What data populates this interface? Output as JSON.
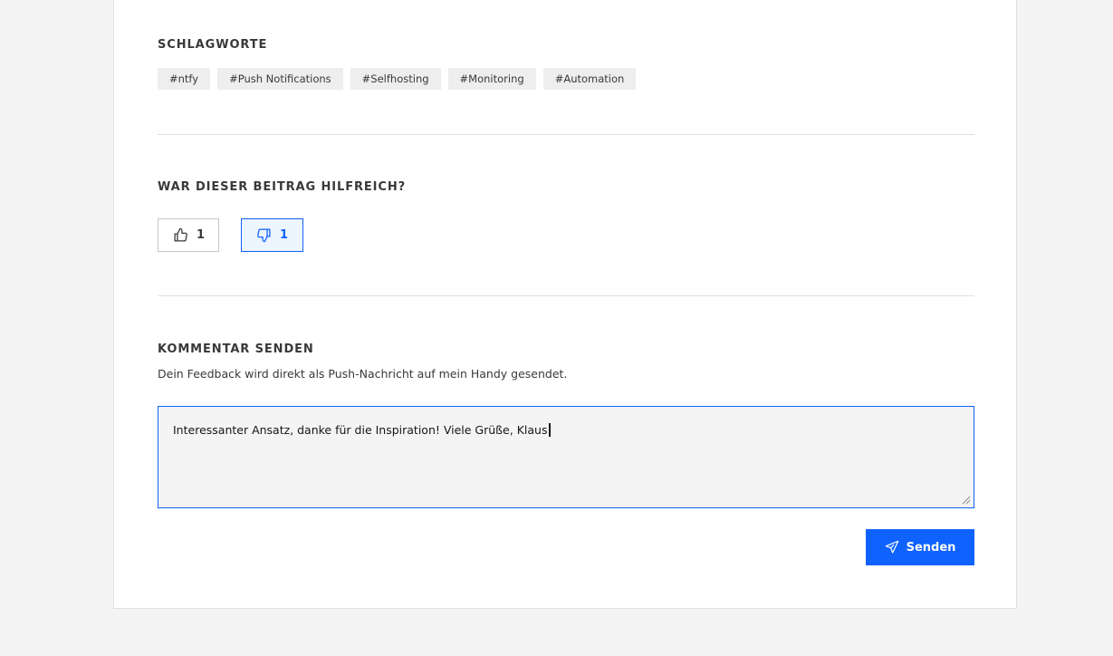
{
  "tags_section": {
    "heading": "SCHLAGWORTE",
    "tags": [
      "#ntfy",
      "#Push Notifications",
      "#Selfhosting",
      "#Monitoring",
      "#Automation"
    ]
  },
  "feedback_section": {
    "heading": "WAR DIESER BEITRAG HILFREICH?",
    "thumbs_up_count": "1",
    "thumbs_down_count": "1",
    "active_vote": "thumbs-down"
  },
  "comment_section": {
    "heading": "KOMMENTAR SENDEN",
    "description": "Dein Feedback wird direkt als Push-Nachricht auf mein Handy gesendet.",
    "comment_value": "Interessanter Ansatz, danke für die Inspiration! Viele Grüße, Klaus",
    "send_label": "Senden",
    "send_icon": "send-icon"
  },
  "colors": {
    "accent": "#0f62fe",
    "background": "#f4f4f4",
    "card": "#ffffff",
    "tag_bg": "#eeeeee"
  }
}
